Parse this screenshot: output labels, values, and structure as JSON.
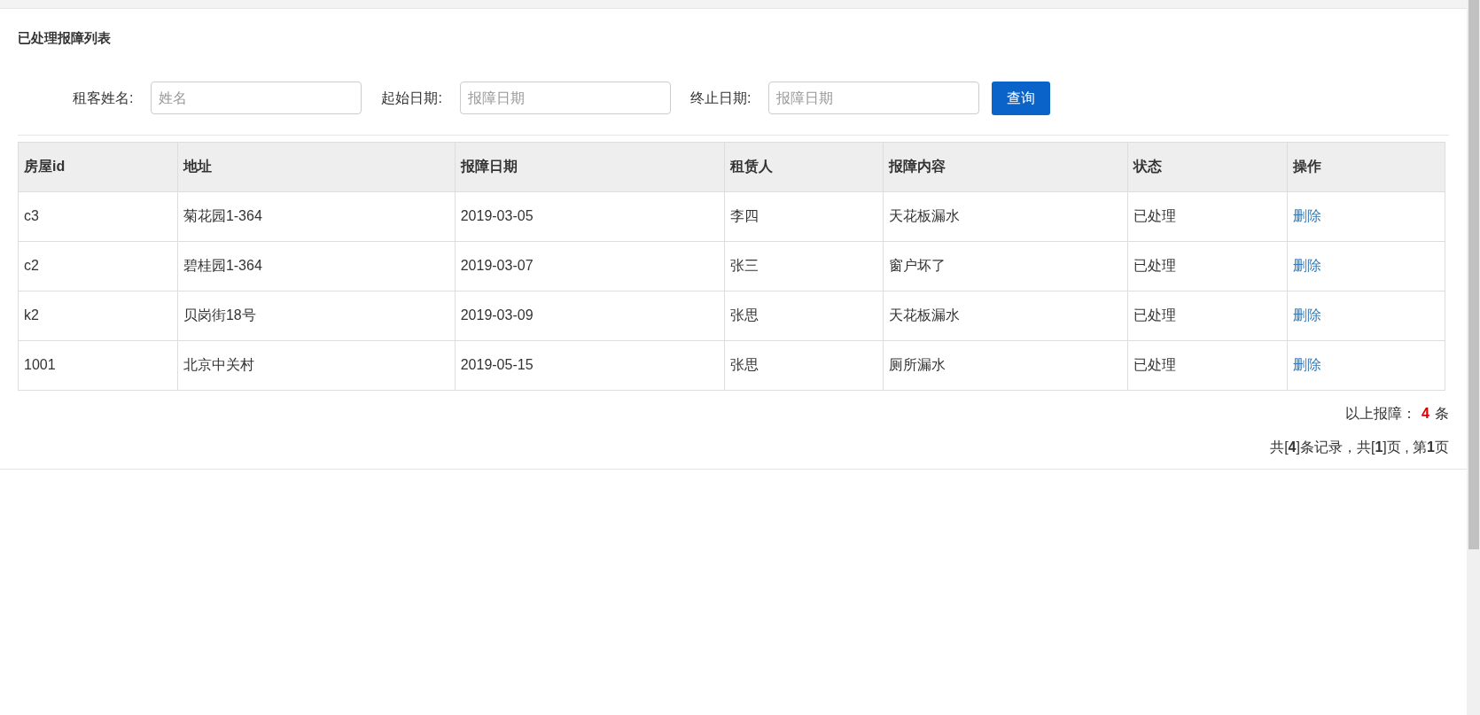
{
  "title": "已处理报障列表",
  "filters": [
    {
      "label": "租客姓名:",
      "placeholder": "姓名"
    },
    {
      "label": "起始日期:",
      "placeholder": "报障日期"
    },
    {
      "label": "终止日期:",
      "placeholder": "报障日期"
    }
  ],
  "search_button": "查询",
  "table": {
    "columns": [
      "房屋id",
      "地址",
      "报障日期",
      "租赁人",
      "报障内容",
      "状态",
      "操作"
    ],
    "rows": [
      {
        "cells": [
          "c3",
          "菊花园1-364",
          "2019-03-05",
          "李四",
          "天花板漏水",
          "已处理"
        ],
        "action": "删除"
      },
      {
        "cells": [
          "c2",
          "碧桂园1-364",
          "2019-03-07",
          "张三",
          "窗户坏了",
          "已处理"
        ],
        "action": "删除"
      },
      {
        "cells": [
          "k2",
          "贝岗街18号",
          "2019-03-09",
          "张思",
          "天花板漏水",
          "已处理"
        ],
        "action": "删除"
      },
      {
        "cells": [
          "1001",
          "北京中关村",
          "2019-05-15",
          "张思",
          "厕所漏水",
          "已处理"
        ],
        "action": "删除"
      }
    ]
  },
  "summary": {
    "prefix": "以上报障：",
    "count": "4",
    "suffix": "条"
  },
  "pagination": "共[**4**]条记录，共[**1**]页 , 第**1**页"
}
